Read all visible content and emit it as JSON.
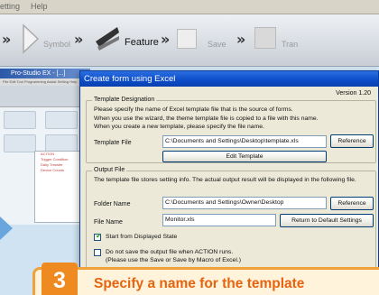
{
  "background": {
    "menubar": [
      "etting",
      "Help"
    ],
    "toolbar_steps": [
      "Symbol",
      "Feature",
      "Save",
      "Tran"
    ],
    "app_title": "Pro-Studio EX - [...]",
    "app_menu": "File  Edit  Tool  Programming Assist  Setting  Help",
    "tree_items": [
      "ACTION",
      "Trigger Condition",
      "Daily Transfer",
      "Device Counts"
    ]
  },
  "dialog": {
    "title": "Create form using Excel",
    "version": "Version 1.20",
    "template": {
      "legend": "Template Designation",
      "description": [
        "Please specify the name of Excel template file that is the source of forms.",
        "When you use the wizard, the theme template file is copied to a file with this name.",
        "When you create a new template, please specify the file name."
      ],
      "file_label": "Template File",
      "file_value": "C:\\Documents and Settings\\Desktop\\template.xls",
      "reference_button": "Reference",
      "edit_button": "Edit Template"
    },
    "output": {
      "legend": "Output File",
      "description": "The template file stores setting info. The actual output result will be displayed in the following file.",
      "folder_label": "Folder Name",
      "folder_value": "C:\\Documents and Settings\\Owner\\Desktop",
      "reference_button": "Reference",
      "file_label": "File Name",
      "file_value": "Monitor.xls",
      "default_button": "Return to Default Settings",
      "start_displayed": {
        "label": "Start from Displayed State",
        "checked": true
      },
      "no_save": {
        "line1": "Do not save the output file when ACTION runs.",
        "line2": "(Please use the Save or Save by Macro of Excel.)",
        "checked": false
      }
    }
  },
  "callout": {
    "step": "3",
    "text": "Specify a name for the template"
  },
  "colors": {
    "accent_orange": "#ee8a1f",
    "callout_text": "#e5640f",
    "title_blue": "#0c4cc8"
  }
}
